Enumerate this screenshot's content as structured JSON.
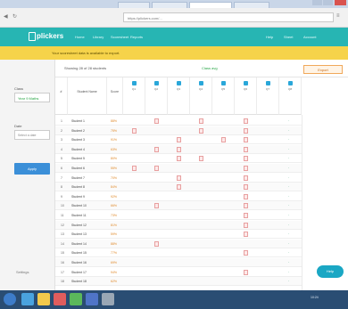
{
  "browser": {
    "url": "https://plickers.com/..."
  },
  "app": {
    "logo": "plickers",
    "nav_links": [
      "Home",
      "Library",
      "Scoresheet",
      "Reports"
    ],
    "right_links": [
      "Help",
      "Sheet",
      "Account"
    ]
  },
  "banner": {
    "text": "Your scoresheet data is available to export."
  },
  "sidebar": {
    "label_class": "Class",
    "class_value": "Year 9 Maths",
    "label_date": "Date",
    "date_value": "Select a date",
    "button_label": "Apply",
    "footer": "Settings"
  },
  "scorebar": {
    "left_text": "Showing 28 of 28 students",
    "center_text": "Class avg",
    "export_label": "Export"
  },
  "header": {
    "num": "#",
    "name": "Student Name",
    "score": "Score",
    "questions": [
      "Q1",
      "Q2",
      "Q3",
      "Q4",
      "Q5",
      "Q6",
      "Q7",
      "Q8"
    ]
  },
  "rows": [
    {
      "num": "1",
      "name": "Student 1",
      "score": "88%"
    },
    {
      "num": "2",
      "name": "Student 2",
      "score": "75%"
    },
    {
      "num": "3",
      "name": "Student 3",
      "score": "91%"
    },
    {
      "num": "4",
      "name": "Student 4",
      "score": "63%"
    },
    {
      "num": "5",
      "name": "Student 5",
      "score": "80%"
    },
    {
      "num": "6",
      "name": "Student 6",
      "score": "55%"
    },
    {
      "num": "7",
      "name": "Student 7",
      "score": "70%"
    },
    {
      "num": "8",
      "name": "Student 8",
      "score": "84%"
    },
    {
      "num": "9",
      "name": "Student 9",
      "score": "92%"
    },
    {
      "num": "10",
      "name": "Student 10",
      "score": "66%"
    },
    {
      "num": "11",
      "name": "Student 11",
      "score": "73%"
    },
    {
      "num": "12",
      "name": "Student 12",
      "score": "81%"
    },
    {
      "num": "13",
      "name": "Student 13",
      "score": "59%"
    },
    {
      "num": "14",
      "name": "Student 14",
      "score": "88%"
    },
    {
      "num": "15",
      "name": "Student 15",
      "score": "77%"
    },
    {
      "num": "16",
      "name": "Student 16",
      "score": "69%"
    },
    {
      "num": "17",
      "name": "Student 17",
      "score": "94%"
    },
    {
      "num": "18",
      "name": "Student 18",
      "score": "62%"
    }
  ],
  "fab_label": "Help",
  "taskbar": {
    "clock": "10:24"
  }
}
